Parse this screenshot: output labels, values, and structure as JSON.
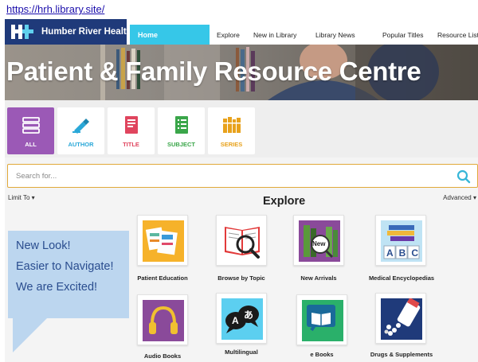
{
  "address_bar": {
    "url": "https://hrh.library.site/"
  },
  "header": {
    "logo_text": "Humber River Health",
    "nav": [
      {
        "label": "Home",
        "active": true
      },
      {
        "label": "Explore"
      },
      {
        "label": "New in Library"
      },
      {
        "label": "Library News"
      },
      {
        "label": "Popular Titles"
      },
      {
        "label": "Resource List"
      }
    ]
  },
  "banner": {
    "title": "Patient & Family Resource Centre"
  },
  "filters": [
    {
      "label": "ALL",
      "icon": "stack-icon",
      "color": "#ffffff",
      "active": true
    },
    {
      "label": "AUTHOR",
      "icon": "pen-icon",
      "color": "#2aa8d8"
    },
    {
      "label": "TITLE",
      "icon": "book-title-icon",
      "color": "#e0455e"
    },
    {
      "label": "SUBJECT",
      "icon": "list-icon",
      "color": "#3aa64a"
    },
    {
      "label": "SERIES",
      "icon": "books-series-icon",
      "color": "#e8a21c"
    }
  ],
  "search": {
    "placeholder": "Search for...",
    "limit_label": "Limit To",
    "advanced_label": "Advanced"
  },
  "explore": {
    "heading": "Explore",
    "tiles": [
      {
        "label": "Patient Education",
        "icon": "patient-education-icon"
      },
      {
        "label": "Browse by Topic",
        "icon": "browse-topic-icon"
      },
      {
        "label": "New Arrivals",
        "icon": "new-arrivals-icon",
        "badge": "New"
      },
      {
        "label": "Medical Encyclopedias",
        "icon": "encyclopedia-icon",
        "letters": "ABC"
      },
      {
        "label": "Audio Books",
        "icon": "headphones-icon"
      },
      {
        "label": "Multilingual",
        "icon": "multilingual-icon",
        "glyph_a": "A",
        "glyph_b": "あ"
      },
      {
        "label": "e Books",
        "icon": "ebook-icon"
      },
      {
        "label": "Drugs & Supplements",
        "icon": "pill-bottle-icon"
      }
    ]
  },
  "callout": {
    "lines": [
      "New Look!",
      "Easier to Navigate!",
      "We are Excited!"
    ]
  }
}
